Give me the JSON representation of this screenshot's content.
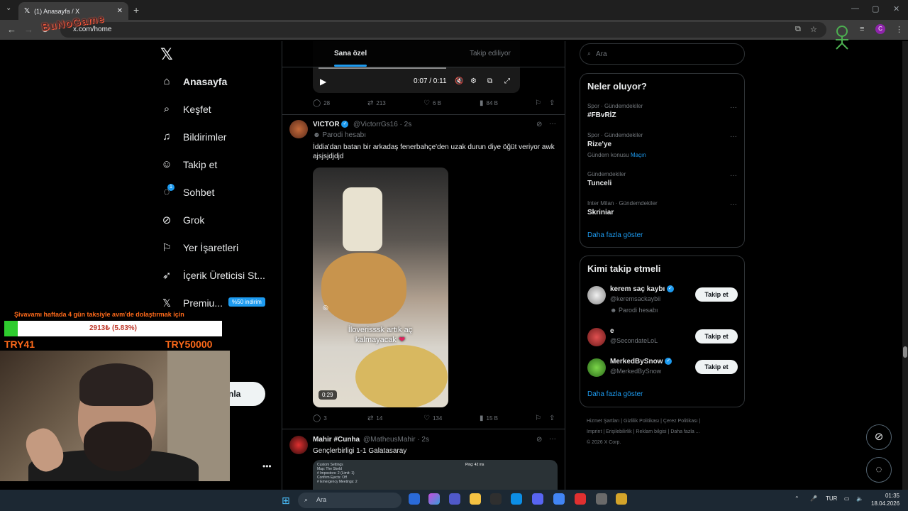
{
  "browser": {
    "tab_title": "(1) Anasayfa / X",
    "url": "x.com/home",
    "profile_initial": "C"
  },
  "overlay": {
    "logo_text": "BuNoGame",
    "donation_title": "Şivavamı haftada 4 gün taksiyle avm'de dolaştırmak için",
    "donation_progress": "2913₺ (5.83%)",
    "donation_fraction": 0.0583,
    "goal_left": "TRY41",
    "goal_right": "TRY50000"
  },
  "nav": {
    "items": [
      {
        "label": "Anasayfa",
        "icon": "home-icon"
      },
      {
        "label": "Keşfet",
        "icon": "search-icon"
      },
      {
        "label": "Bildirimler",
        "icon": "bell-icon"
      },
      {
        "label": "Takip et",
        "icon": "person-add-icon"
      },
      {
        "label": "Sohbet",
        "icon": "chat-icon"
      },
      {
        "label": "Grok",
        "icon": "grok-icon"
      },
      {
        "label": "Yer İşaretleri",
        "icon": "bookmark-icon"
      },
      {
        "label": "İçerik Üreticisi St...",
        "icon": "rocket-icon"
      },
      {
        "label": "Premiu...",
        "icon": "x-icon"
      }
    ],
    "chat_badge": "1",
    "promo_badge": "%50 indirim",
    "post_button": "nla"
  },
  "feed": {
    "tabs": [
      "Sana özel",
      "Takip ediliyor"
    ],
    "video1": {
      "time": "0:07 / 0:11"
    },
    "post1_stats": {
      "replies": "28",
      "reposts": "213",
      "likes": "6 B",
      "views": "84 B"
    },
    "post2": {
      "name": "VICTOR",
      "handle": "@VictorrGs16 · 2s",
      "sub": "Parodi hesabı",
      "text": "İddia'dan batan bir arkadaş fenerbahçe'den uzak durun diye öğüt veriyor awk ajsjsjdjdjd",
      "media_caption": "İloverisssk artık aç kalmayacak",
      "media_duration": "0:29",
      "stats": {
        "replies": "3",
        "reposts": "14",
        "likes": "134",
        "views": "15 B"
      }
    },
    "post3": {
      "name": "Mahir #Cunha",
      "handle": "@MatheusMahir · 2s",
      "text": "Gençlerbirligi 1-1 Galatasaray",
      "settings_text": "Custom Settings\nMap: The Skeld\n# Impostors: 2 (Limit: 1)\nConfirm Ejects: Off\n# Emergency Meetings: 2",
      "ping": "Ping: 42 ms"
    }
  },
  "right": {
    "search_placeholder": "Ara",
    "trends_title": "Neler oluyor?",
    "trends": [
      {
        "meta": "Spor · Gündemdekiler",
        "name": "#FBvRİZ",
        "sub": ""
      },
      {
        "meta": "Spor · Gündemdekiler",
        "name": "Rize'ye",
        "sub": "Gündem konusu",
        "sub_link": "Maçın"
      },
      {
        "meta": "Gündemdekiler",
        "name": "Tunceli",
        "sub": ""
      },
      {
        "meta": "Inter Milan · Gündemdekiler",
        "name": "Skriniar",
        "sub": ""
      }
    ],
    "trends_more": "Daha fazla göster",
    "who_title": "Kimi takip etmeli",
    "who": [
      {
        "name": "kerem saç kaybı",
        "handle": "@keremsackaybii",
        "sub": "Parodi hesabı",
        "button": "Takip et"
      },
      {
        "name": "e",
        "handle": "@SecondateLoL",
        "sub": "",
        "button": "Takip et"
      },
      {
        "name": "MerkedBySnow",
        "handle": "@MerkedBySnow",
        "sub": "",
        "button": "Takip et"
      }
    ],
    "who_more": "Daha fazla göster",
    "footer": [
      "Hizmet Şartları",
      "Gizlilik Politikası",
      "Çerez Politikası",
      "Imprint",
      "Erişilebilirlik",
      "Reklam bilgisi",
      "Daha fazla ...",
      "© 2026 X Corp."
    ]
  },
  "taskbar": {
    "search_placeholder": "Ara",
    "lang": "TUR",
    "time": "01:35",
    "date": "18.04.2026"
  }
}
